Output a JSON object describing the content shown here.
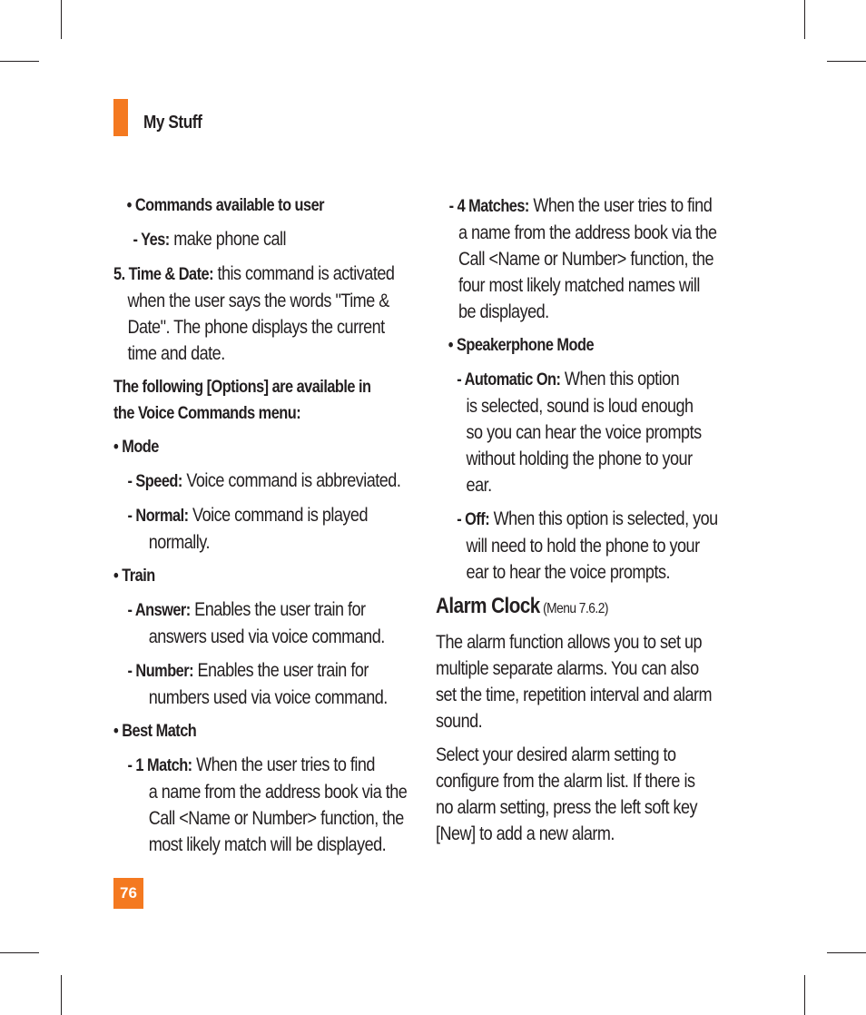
{
  "header": {
    "title": "My Stuff"
  },
  "left": {
    "commands_head": "Commands available to user",
    "yes_label": "- Yes:",
    "yes_text": " make phone call",
    "time_num": "5. ",
    "time_label": "Time & Date:",
    "time_lines": [
      " this command is activated",
      "when the user says the words \"Time &",
      "Date\". The phone displays the current",
      "time and date."
    ],
    "options_lines": [
      "The following [Options] are available in",
      "the Voice Commands menu:"
    ],
    "mode_head": "Mode",
    "speed_label": "- Speed:",
    "speed_text": " Voice command is abbreviated.",
    "normal_label": "- Normal:",
    "normal_lines": [
      " Voice command is played",
      "normally."
    ],
    "train_head": "Train",
    "answer_label": "- Answer:",
    "answer_lines": [
      " Enables the user train for",
      "answers used via voice command."
    ],
    "number_label": "- Number:",
    "number_lines": [
      " Enables the user train for",
      "numbers used via voice command."
    ],
    "best_head": "Best Match",
    "match1_label": "- 1 Match:",
    "match1_lines": [
      " When the user tries to find",
      "a name from the address book via the",
      "Call <Name or Number> function, the",
      "most likely match will be displayed."
    ]
  },
  "right": {
    "match4_label": "- 4 Matches:",
    "match4_lines": [
      " When the user tries to find",
      "a name from the address book via the",
      "Call <Name or Number> function, the",
      "four most likely matched names will",
      "be displayed."
    ],
    "speaker_head": "Speakerphone Mode",
    "auto_label": "- Automatic On:",
    "auto_lines": [
      " When this option",
      "is selected, sound is loud enough",
      "so you can hear the voice prompts",
      "without holding the phone to your",
      "ear."
    ],
    "off_label": "- Off:",
    "off_lines": [
      " When this option is selected, you",
      "will need to hold the phone to your",
      "ear to hear the voice prompts."
    ],
    "alarm_title": "Alarm Clock",
    "alarm_menu": " (Menu 7.6.2)",
    "alarm_p1": [
      "The alarm function allows you to set up",
      "multiple separate alarms. You can also",
      "set the time, repetition interval and alarm",
      "sound."
    ],
    "alarm_p2": [
      "Select your desired alarm setting to",
      "configure from the alarm list. If there is",
      "no alarm setting, press the left soft key",
      "[New] to add a new alarm."
    ]
  },
  "footer": {
    "page_number": "76"
  },
  "colors": {
    "accent": "#f47920",
    "text": "#231f20"
  }
}
